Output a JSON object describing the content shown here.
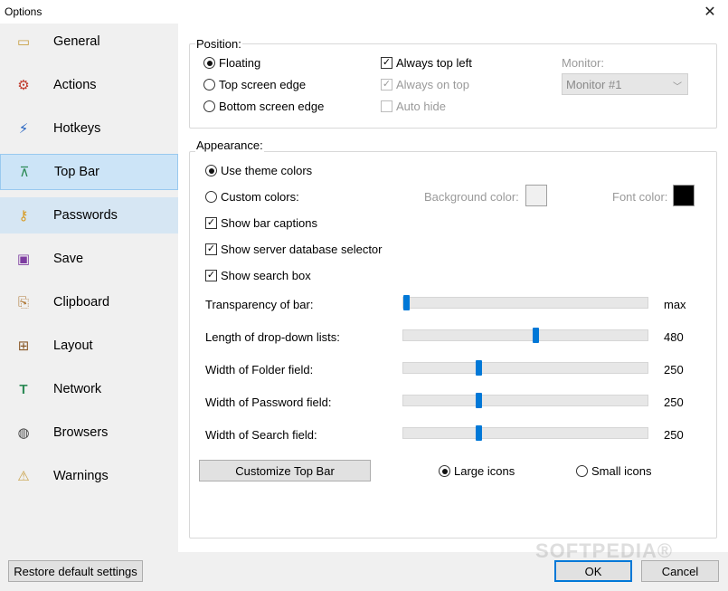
{
  "window": {
    "title": "Options",
    "close_glyph": "✕"
  },
  "sidebar": {
    "items": [
      {
        "label": "General",
        "icon": "general-icon",
        "glyph": "📁",
        "color": "#c8a045"
      },
      {
        "label": "Actions",
        "icon": "gear-icon",
        "glyph": "⚙",
        "color": "#c0392b"
      },
      {
        "label": "Hotkeys",
        "icon": "hotkey-icon",
        "glyph": "⚡",
        "color": "#1f5fbf"
      },
      {
        "label": "Top Bar",
        "icon": "topbar-icon",
        "glyph": "⊼",
        "color": "#2e8b57",
        "state": "selected"
      },
      {
        "label": "Passwords",
        "icon": "key-icon",
        "glyph": "🔑",
        "color": "#d89a20",
        "state": "hover"
      },
      {
        "label": "Save",
        "icon": "save-icon",
        "glyph": "💾",
        "color": "#7d3ca0"
      },
      {
        "label": "Clipboard",
        "icon": "clipboard-icon",
        "glyph": "📋",
        "color": "#b07a3a"
      },
      {
        "label": "Layout",
        "icon": "layout-icon",
        "glyph": "⊞",
        "color": "#8a5a2a"
      },
      {
        "label": "Network",
        "icon": "network-icon",
        "glyph": "T",
        "color": "#2e8b57"
      },
      {
        "label": "Browsers",
        "icon": "globe-icon",
        "glyph": "🌐",
        "color": "#444444"
      },
      {
        "label": "Warnings",
        "icon": "warning-icon",
        "glyph": "⚠",
        "color": "#c8a045"
      }
    ]
  },
  "position": {
    "legend": "Position:",
    "floating": "Floating",
    "top_edge": "Top screen edge",
    "bottom_edge": "Bottom screen edge",
    "always_top_left": "Always top left",
    "always_on_top": "Always on top",
    "auto_hide": "Auto hide",
    "monitor_label": "Monitor:",
    "monitor_value": "Monitor #1"
  },
  "appearance": {
    "legend": "Appearance:",
    "theme_colors": "Use theme colors",
    "custom_colors": "Custom colors:",
    "background_color_label": "Background color:",
    "font_color_label": "Font color:",
    "background_color": "#f0f0f0",
    "font_color": "#000000",
    "show_bar_captions": "Show bar captions",
    "show_db_selector": "Show server database selector",
    "show_search_box": "Show search box",
    "sliders": [
      {
        "label": "Transparency of bar:",
        "value": "max",
        "level": 0.0
      },
      {
        "label": "Length of drop-down lists:",
        "value": "480",
        "level": 0.54
      },
      {
        "label": "Width of Folder field:",
        "value": "250",
        "level": 0.3
      },
      {
        "label": "Width of Password field:",
        "value": "250",
        "level": 0.3
      },
      {
        "label": "Width of Search field:",
        "value": "250",
        "level": 0.3
      }
    ],
    "customize_button": "Customize Top Bar",
    "large_icons": "Large icons",
    "small_icons": "Small icons"
  },
  "footer": {
    "restore_button": "Restore default settings",
    "ok_button": "OK",
    "cancel_button": "Cancel"
  },
  "watermark": "SOFTPEDIA®",
  "colors": {
    "accent": "#0078d7",
    "selected_bg": "#cce4f7",
    "hover_bg": "#d6e6f3"
  }
}
